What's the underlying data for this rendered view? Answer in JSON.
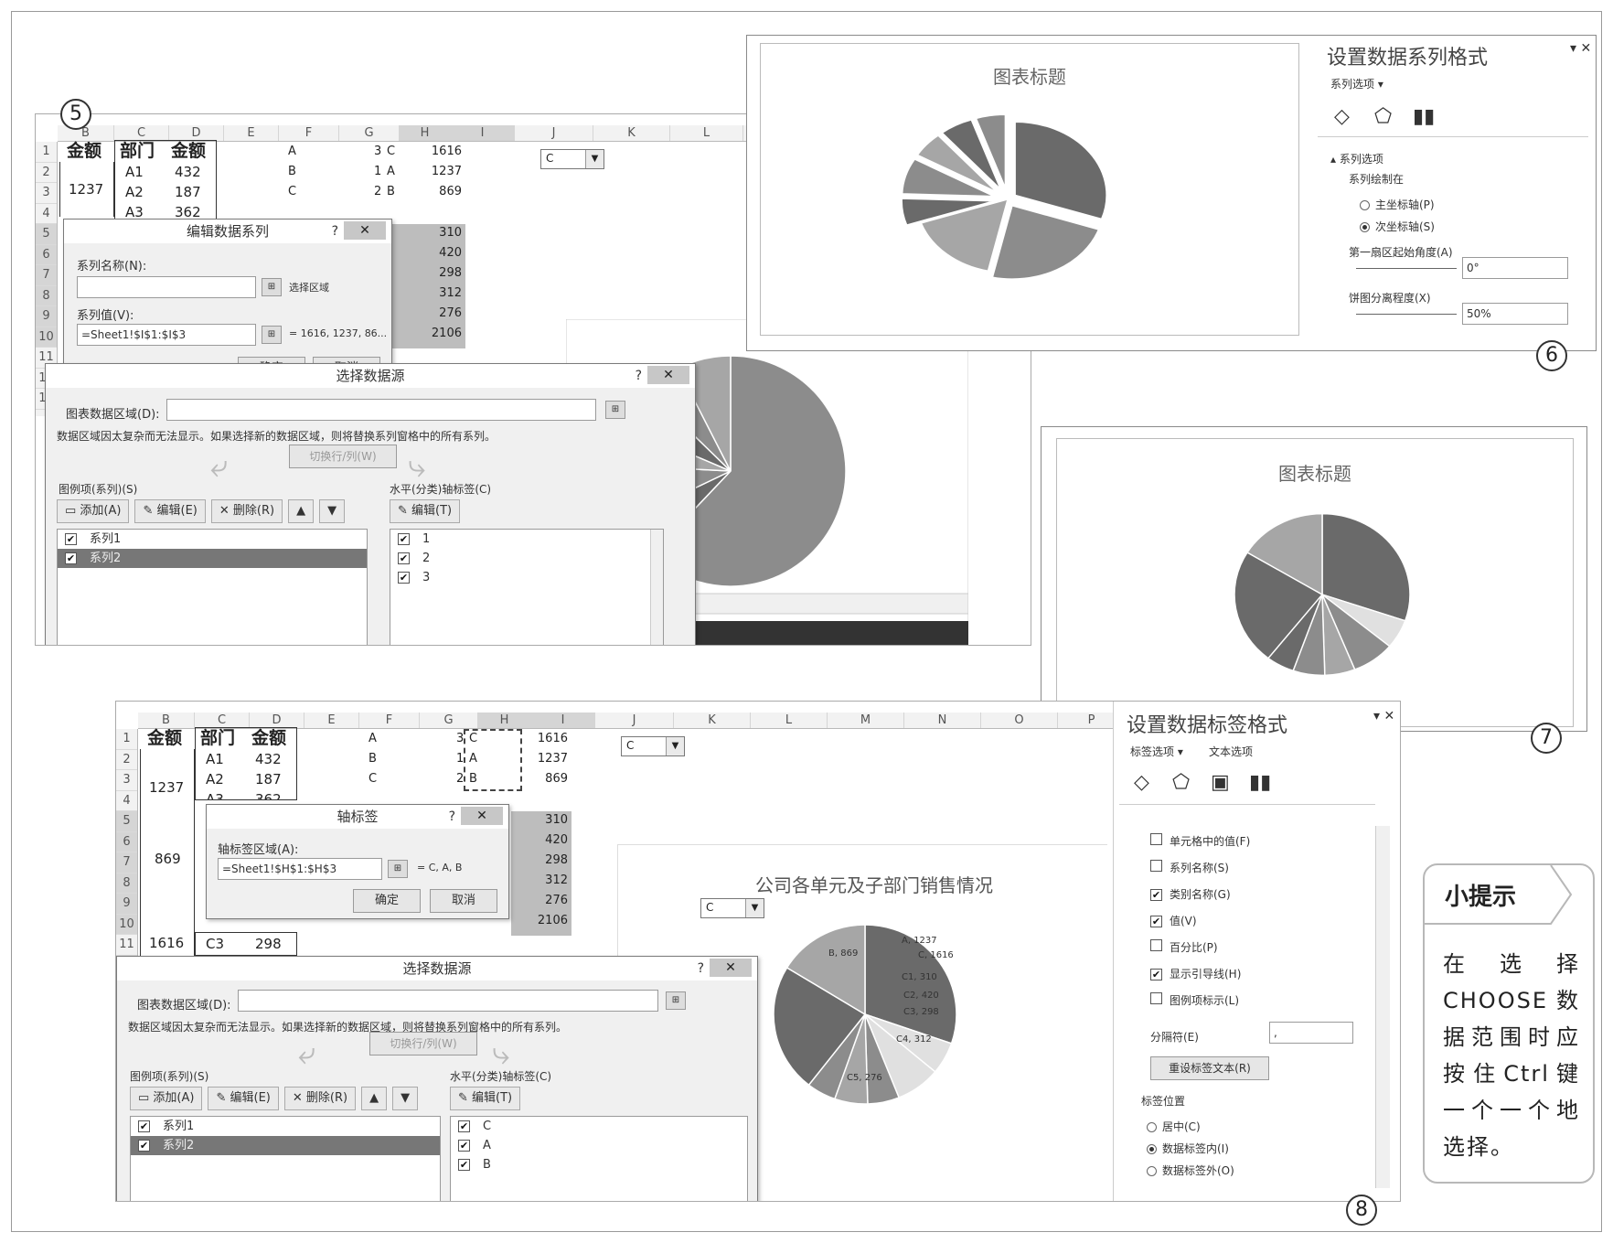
{
  "step_numbers": {
    "s5": "5",
    "s6": "6",
    "s7": "7",
    "s8": "8"
  },
  "sheet1": {
    "col_headers": [
      "B",
      "C",
      "D",
      "E",
      "F",
      "G",
      "H",
      "I",
      "J",
      "K",
      "L"
    ],
    "row_headers": [
      "1",
      "2",
      "3",
      "4",
      "5",
      "6",
      "7",
      "8",
      "9",
      "10",
      "11",
      "12",
      "13"
    ],
    "header_amount": "金额",
    "header_dept": "部门",
    "header_amount2": "金额",
    "merged_1237": "1237",
    "depts": [
      "A1",
      "A2",
      "A3"
    ],
    "dept_amounts": [
      "432",
      "187",
      "362"
    ],
    "f_col": [
      "A",
      "B",
      "C"
    ],
    "g_col": [
      "3",
      "1",
      "2"
    ],
    "h_col": [
      "C",
      "A",
      "B"
    ],
    "i_top": [
      "1616",
      "1237",
      "869"
    ],
    "i_bottom": [
      "310",
      "420",
      "298",
      "312",
      "276",
      "2106"
    ],
    "dropdown_value": "C"
  },
  "edit_series_dialog": {
    "title": "编辑数据系列",
    "help": "?",
    "close": "✕",
    "name_label": "系列名称(N):",
    "name_hint": "选择区域",
    "values_label": "系列值(V):",
    "values_value": "=Sheet1!$I$1:$I$3",
    "values_preview": "= 1616, 1237, 86...",
    "ok": "确定",
    "cancel": "取消"
  },
  "select_source_dialog_1": {
    "title": "选择数据源",
    "help": "?",
    "close": "✕",
    "range_label": "图表数据区域(D):",
    "message": "数据区域因太复杂而无法显示。如果选择新的数据区域，则将替换系列窗格中的所有系列。",
    "switch_label": "切换行/列(W)",
    "legend_label": "图例项(系列)(S)",
    "axis_label": "水平(分类)轴标签(C)",
    "add": "添加(A)",
    "edit": "编辑(E)",
    "delete": "删除(R)",
    "axis_edit": "编辑(T)",
    "series": [
      "系列1",
      "系列2"
    ],
    "categories": [
      "1",
      "2",
      "3"
    ]
  },
  "chart6": {
    "title": "图表标题",
    "chart_data": {
      "type": "pie",
      "title": "图表标题",
      "description_free": true,
      "slices": [
        1616,
        1237,
        869,
        310,
        420,
        298,
        312,
        276
      ]
    }
  },
  "format_series_pane": {
    "title": "设置数据系列格式",
    "dropdown": "系列选项",
    "section": "系列选项",
    "plot_on": "系列绘制在",
    "primary": "主坐标轴(P)",
    "secondary": "次坐标轴(S)",
    "angle_label": "第一扇区起始角度(A)",
    "angle_value": "0°",
    "explosion_label": "饼图分离程度(X)",
    "explosion_value": "50%"
  },
  "chart7": {
    "title": "图表标题"
  },
  "sheet2": {
    "col_headers": [
      "B",
      "C",
      "D",
      "E",
      "F",
      "G",
      "H",
      "I",
      "J",
      "K",
      "L",
      "M",
      "N",
      "O",
      "P"
    ],
    "row_headers": [
      "1",
      "2",
      "3",
      "4",
      "5",
      "6",
      "7",
      "8",
      "9",
      "10",
      "11"
    ],
    "header_amount": "金额",
    "header_dept": "部门",
    "header_amount2": "金额",
    "merged_1237": "1237",
    "merged_869": "869",
    "merged_1616": "1616",
    "depts": [
      "A1",
      "A2",
      "A3"
    ],
    "dept_amounts": [
      "432",
      "187",
      "362"
    ],
    "c3": "C3",
    "c3_amount": "298",
    "f_col": [
      "A",
      "B",
      "C"
    ],
    "g_col": [
      "3",
      "1",
      "2"
    ],
    "h_col": [
      "C",
      "A",
      "B"
    ],
    "i_top": [
      "1616",
      "1237",
      "869"
    ],
    "i_bottom": [
      "310",
      "420",
      "298",
      "312",
      "276",
      "2106"
    ],
    "dropdown_value": "C"
  },
  "axis_label_dialog": {
    "title": "轴标签",
    "help": "?",
    "close": "✕",
    "range_label": "轴标签区域(A):",
    "range_value": "=Sheet1!$H$1:$H$3",
    "preview": "= C, A, B",
    "ok": "确定",
    "cancel": "取消"
  },
  "select_source_dialog_2": {
    "title": "选择数据源",
    "help": "?",
    "close": "✕",
    "range_label": "图表数据区域(D):",
    "message": "数据区域因太复杂而无法显示。如果选择新的数据区域，则将替换系列窗格中的所有系列。",
    "switch_label": "切换行/列(W)",
    "legend_label": "图例项(系列)(S)",
    "axis_label": "水平(分类)轴标签(C)",
    "add": "添加(A)",
    "edit": "编辑(E)",
    "delete": "删除(R)",
    "axis_edit": "编辑(T)",
    "series": [
      "系列1",
      "系列2"
    ],
    "categories": [
      "C",
      "A",
      "B"
    ]
  },
  "chart8": {
    "title": "公司各单元及子部门销售情况",
    "dropdown_value": "C",
    "labels": [
      "B, 869",
      "C, 1616",
      "A, 1237",
      "C1, 310",
      "C2, 420",
      "C3, 298",
      "C4, 312",
      "C5, 276"
    ]
  },
  "format_label_pane": {
    "title": "设置数据标签格式",
    "tab_label_options": "标签选项",
    "tab_text_options": "文本选项",
    "options": [
      {
        "text": "单元格中的值(F)",
        "checked": false
      },
      {
        "text": "系列名称(S)",
        "checked": false
      },
      {
        "text": "类别名称(G)",
        "checked": true
      },
      {
        "text": "值(V)",
        "checked": true
      },
      {
        "text": "百分比(P)",
        "checked": false
      },
      {
        "text": "显示引导线(H)",
        "checked": true
      },
      {
        "text": "图例项标示(L)",
        "checked": false
      }
    ],
    "separator_label": "分隔符(E)",
    "separator_value": ",",
    "reset_button": "重设标签文本(R)",
    "position_label": "标签位置",
    "positions": [
      "居中(C)",
      "数据标签内(I)",
      "数据标签外(O)"
    ]
  },
  "tip": {
    "title": "小提示",
    "body": "在选择CHOOSE数据范围时应按住Ctrl键一个一个地选择。"
  },
  "colors": {
    "dark": "#6a6a6a",
    "mid": "#8c8c8c",
    "light": "#a6a6a6",
    "pale": "#e0e0e0"
  }
}
